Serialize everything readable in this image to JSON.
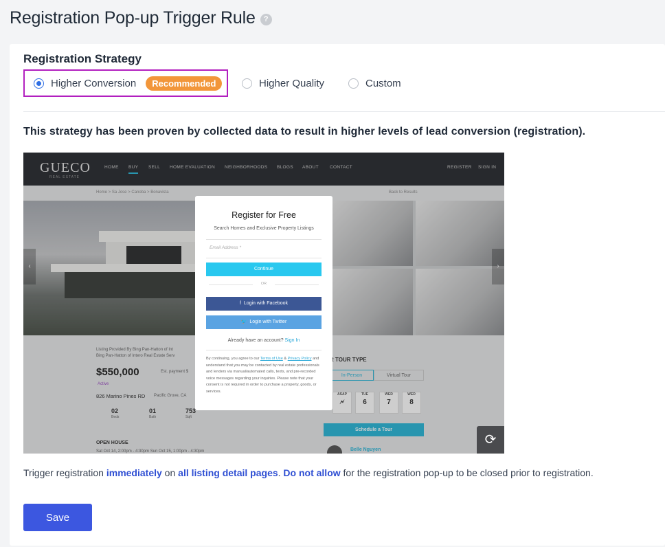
{
  "page": {
    "title": "Registration Pop-up Trigger Rule",
    "help_icon": "?"
  },
  "strategy": {
    "section_title": "Registration Strategy",
    "options": [
      {
        "label": "Higher Conversion",
        "selected": true,
        "badge": "Recommended"
      },
      {
        "label": "Higher Quality",
        "selected": false
      },
      {
        "label": "Custom",
        "selected": false
      }
    ],
    "description": "This strategy has been proven by collected data to result in higher levels of lead conversion (registration)."
  },
  "preview": {
    "logo": "GUECO",
    "logo_sub": "REAL ESTATE",
    "nav": [
      "HOME",
      "BUY",
      "SELL",
      "HOME EVALUATION",
      "NEIGHBORHOODS",
      "BLOGS",
      "ABOUT",
      "CONTACT"
    ],
    "nav_right": [
      "REGISTER",
      "SIGN IN"
    ],
    "breadcrumb": "Home > Sa Jose > Canoba > Bonavista",
    "back_link": "Back to Results",
    "listing_provided": "Listing Provided By Bing Pan-Hatton of Int",
    "listing_provided_2": "Bing Pan-Hatton of Intero Real Estate Serv",
    "price": "$550,000",
    "est_payment": "Est. payment $",
    "status": "Active",
    "address": "826 Marino Pines RD",
    "city": "Pacific Grove, CA",
    "beds": "02",
    "beds_label": "Beds",
    "baths": "01",
    "baths_label": "Bath",
    "sqft": "753",
    "sqft_label": "Sqft",
    "open_house": "OPEN HOUSE",
    "open_house_time": "Sat Oct 14, 2:00pm - 4:30pm Sun Oct 15, 1:00pm - 4:30pm",
    "tour_title": "R TOUR TYPE",
    "tour_tabs": [
      "In-Person",
      "Virtual Tour"
    ],
    "days": [
      {
        "label": "ASAP",
        "num": "🗲"
      },
      {
        "label": "TUE",
        "num": "6"
      },
      {
        "label": "WED",
        "num": "7"
      },
      {
        "label": "WED",
        "num": "8"
      }
    ],
    "schedule_button": "Schedule a Tour",
    "agent_name": "Belle Nguyen",
    "refresh_icon": "⟳",
    "modal": {
      "title": "Register for Free",
      "subtitle": "Search Homes and Exclusive Property Listings",
      "email_placeholder": "Email Address *",
      "continue_button": "Continue",
      "or_text": "OR",
      "facebook_button": "Login with Facebook",
      "twitter_button": "Login with Twitter",
      "have_account": "Already have an account?",
      "sign_in": "Sign In",
      "legal_1": "By continuing, you agree to our ",
      "legal_terms": "Terms of Use",
      "legal_2": " & ",
      "legal_privacy": "Privacy Policy",
      "legal_3": " and understand that you may be contacted by real estate professionals and lenders via manual/automated calls, texts, and pre-recorded voice messages regarding your inquiries. Please note that your consent is not required in order to purchase a property, goods, or services."
    }
  },
  "trigger": {
    "prefix": "Trigger registration ",
    "when": "immediately",
    "mid1": " on ",
    "where": "all listing detail pages",
    "mid2": ". ",
    "close_rule": "Do not allow",
    "suffix": " for the registration pop-up to be closed prior to registration."
  },
  "actions": {
    "save_label": "Save"
  },
  "colors": {
    "accent": "#3c57e0",
    "link_blue": "#2f4fd3",
    "badge_orange": "#f2963a",
    "highlight_border": "#b21fbf"
  }
}
